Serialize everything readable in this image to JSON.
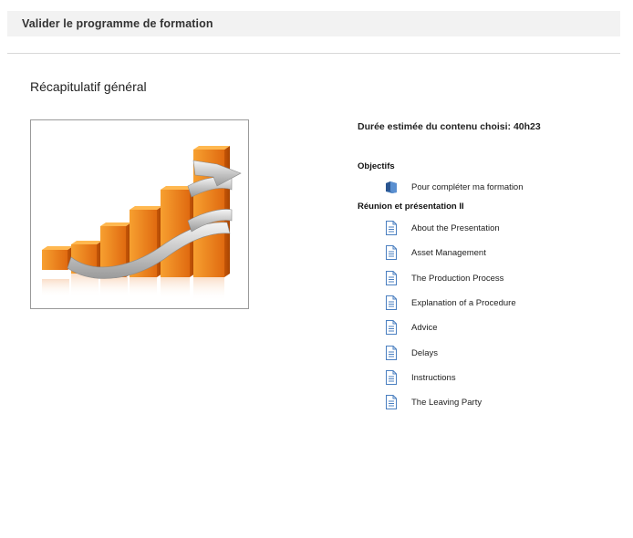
{
  "header": {
    "title": "Valider le programme de formation"
  },
  "summary": {
    "title": "Récapitulatif général",
    "duration_label": "Durée estimée du contenu choisi:",
    "duration_value": "40h23"
  },
  "objectives": {
    "title": "Objectifs",
    "items": [
      {
        "label": "Pour compléter ma formation",
        "icon": "folder-icon"
      }
    ]
  },
  "module": {
    "title": "Réunion et présentation II",
    "items": [
      {
        "label": "About the Presentation",
        "icon": "document-icon"
      },
      {
        "label": "Asset Management",
        "icon": "document-icon"
      },
      {
        "label": "The Production Process",
        "icon": "document-icon"
      },
      {
        "label": "Explanation of a Procedure",
        "icon": "document-icon"
      },
      {
        "label": "Advice",
        "icon": "document-icon"
      },
      {
        "label": "Delays",
        "icon": "document-icon"
      },
      {
        "label": "Instructions",
        "icon": "document-icon"
      },
      {
        "label": "The Leaving Party",
        "icon": "document-icon"
      }
    ]
  },
  "colors": {
    "header_bg": "#f2f2f2",
    "folder": "#3a6fb0",
    "document": "#4a7fc0",
    "bars": "#f08a1a"
  }
}
